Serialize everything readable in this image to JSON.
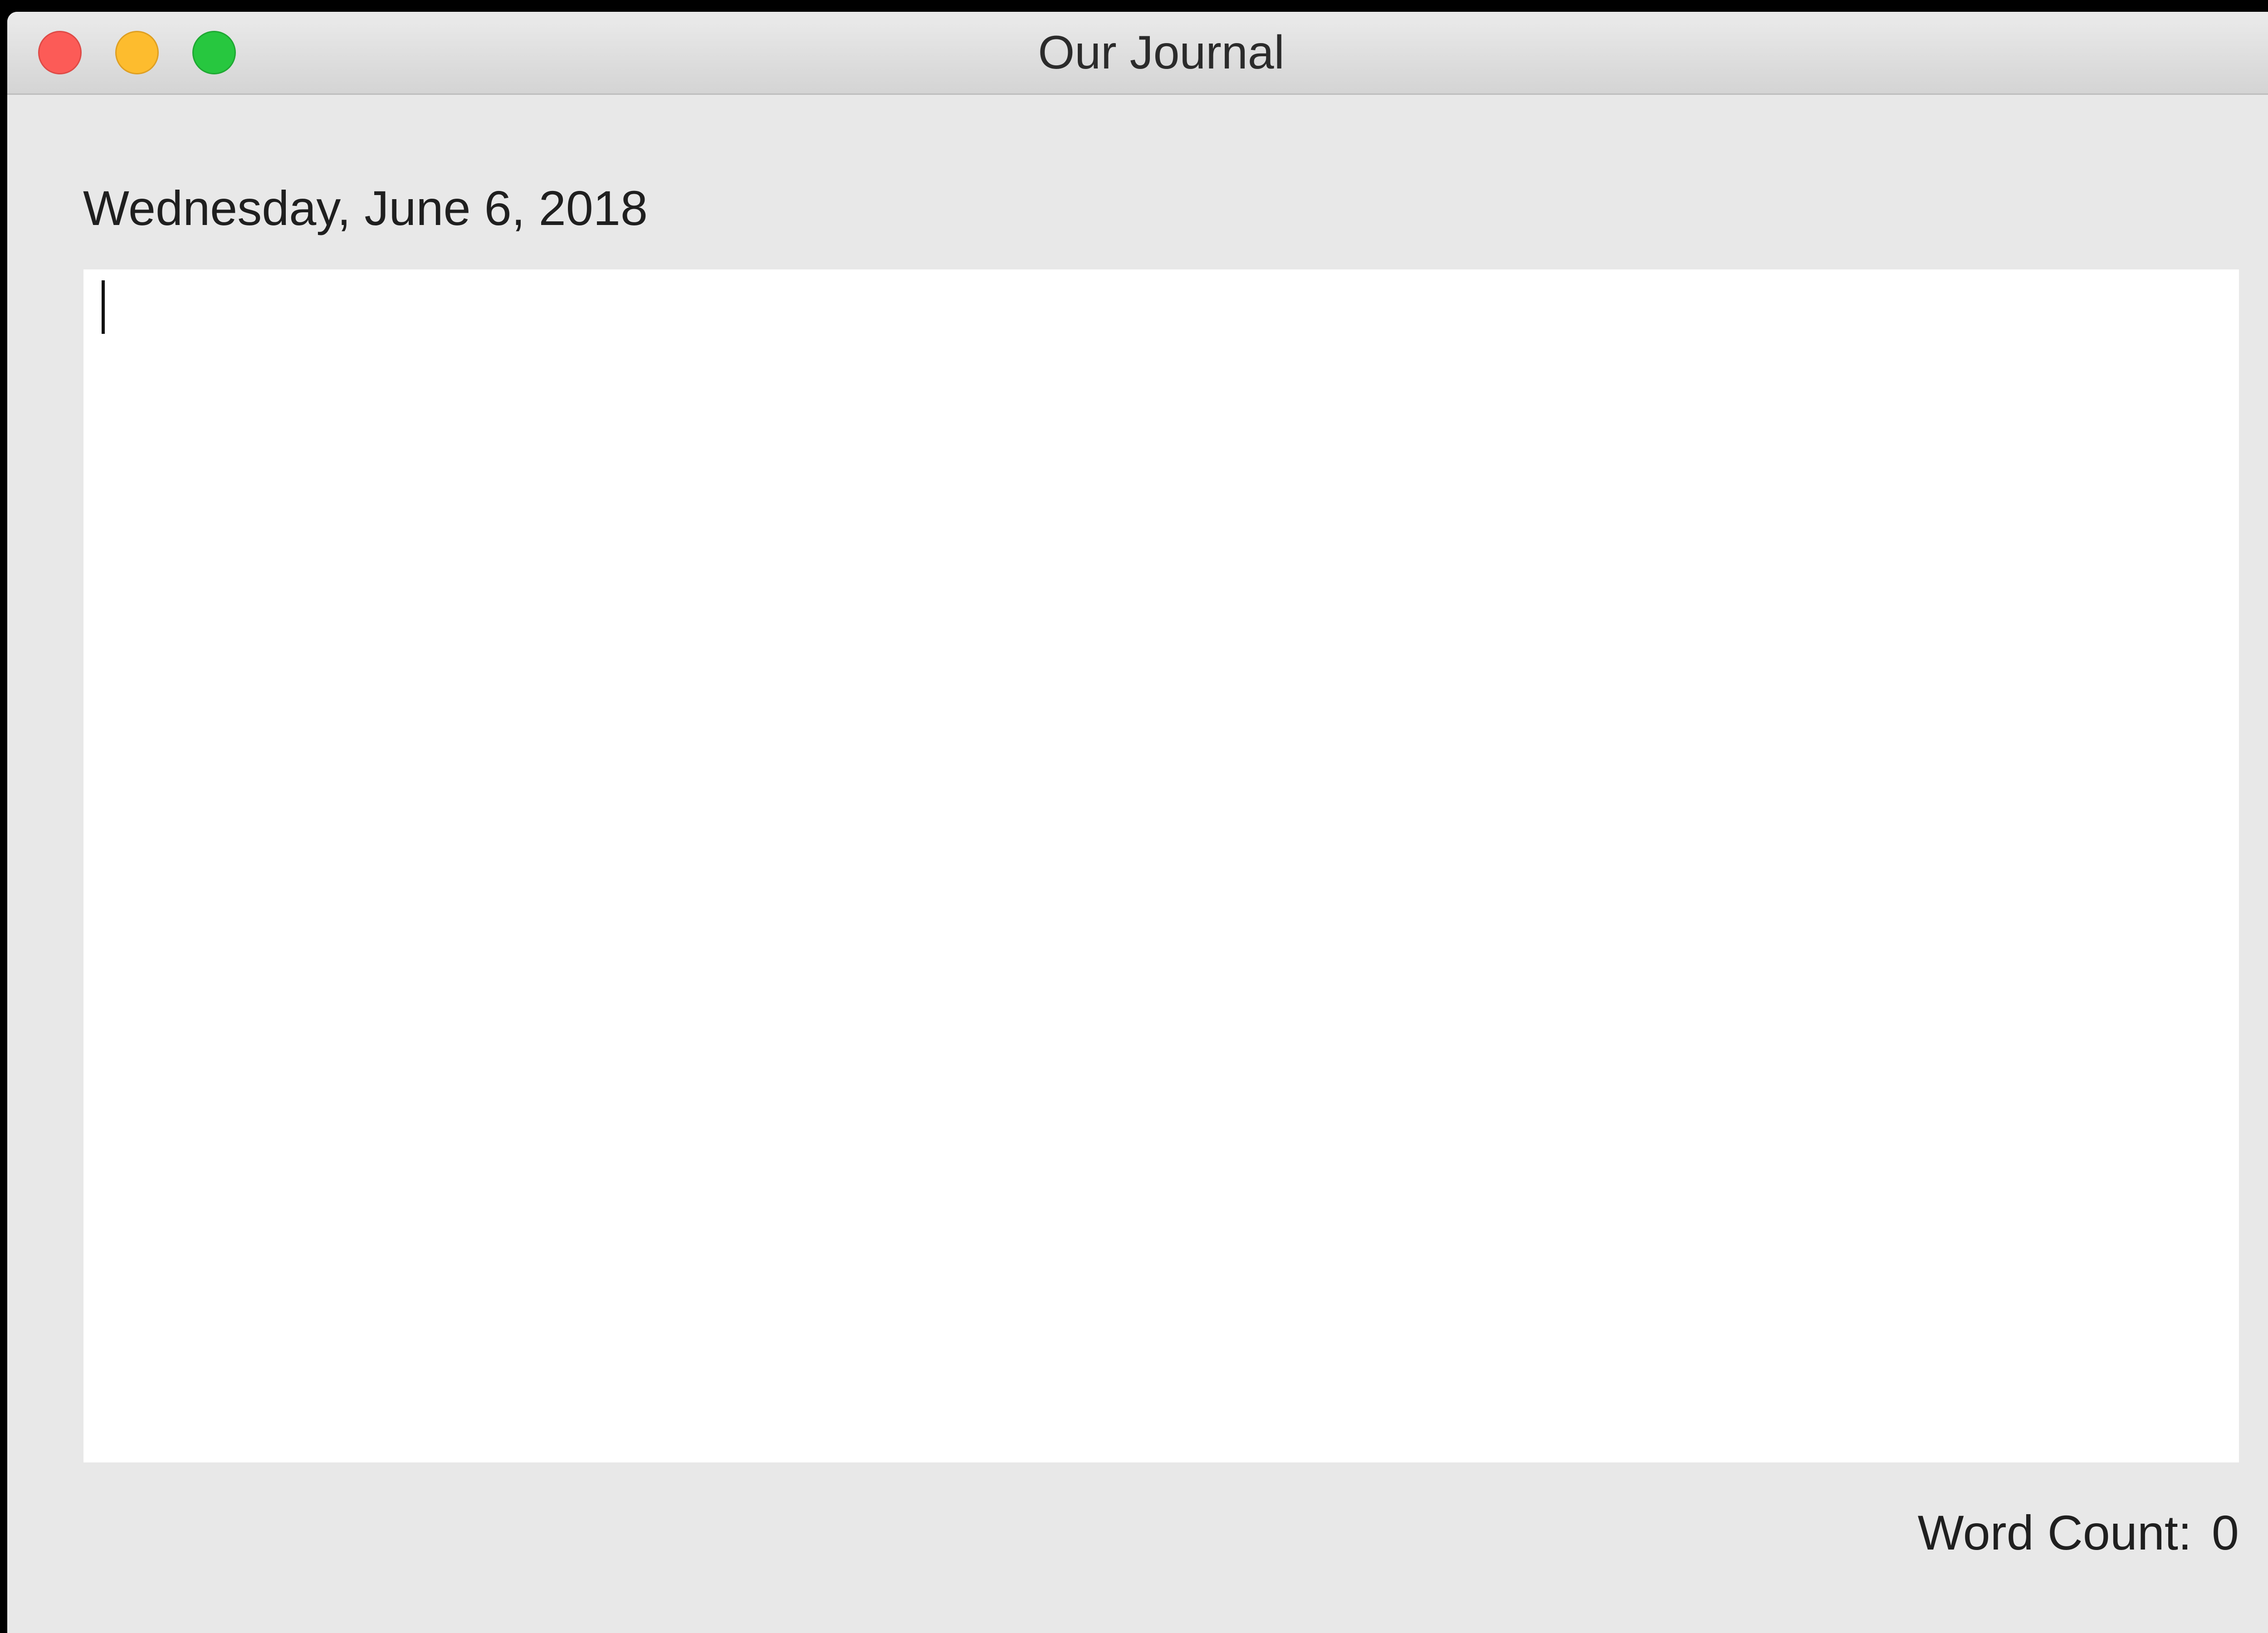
{
  "window": {
    "title": "Our Journal",
    "controls": [
      "close-icon",
      "minimize-icon",
      "zoom-icon"
    ],
    "colors": {
      "close": "#fc5b57",
      "minimize": "#fdbc2e",
      "zoom": "#27c73f"
    }
  },
  "entry": {
    "date": "Wednesday, June 6, 2018",
    "text": ""
  },
  "footer": {
    "word_count_label": "Word Count:",
    "word_count_value": "0"
  }
}
